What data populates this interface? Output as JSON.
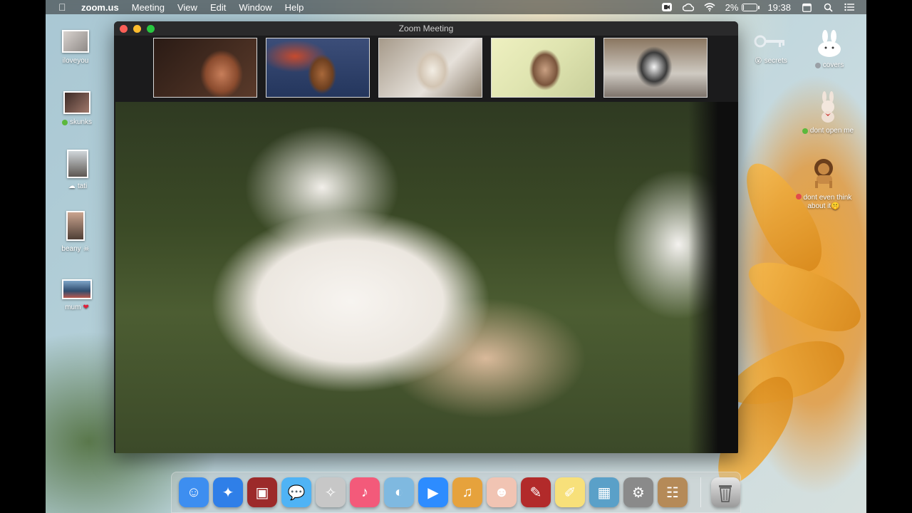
{
  "menubar": {
    "app_name": "zoom.us",
    "menus": [
      "Meeting",
      "View",
      "Edit",
      "Window",
      "Help"
    ],
    "battery_percent": "2%",
    "battery_level": 0.02,
    "clock": "19:38"
  },
  "window": {
    "title": "Zoom Meeting"
  },
  "desktop_left": [
    {
      "label": "iloveyou"
    },
    {
      "label": "skunks",
      "dot_color": "#5cb83c"
    },
    {
      "label": "tati",
      "prefix_glyph": "☁"
    },
    {
      "label": "beany",
      "suffix_glyph": "☠"
    },
    {
      "label": "mum",
      "suffix_glyph": "❤"
    }
  ],
  "desktop_right": [
    {
      "label": "secrets",
      "prefix_glyph": "😮"
    },
    {
      "label": "covers",
      "dot_color": "#9aa0a6"
    },
    {
      "label": "dont open me",
      "dot_color": "#5cb83c"
    },
    {
      "label": "dont even think about it",
      "dot_color": "#e24b4b",
      "suffix_glyph": "🤫"
    }
  ],
  "dock": [
    {
      "name": "finder-icon",
      "color": "#3d8ef0",
      "glyph": "☺"
    },
    {
      "name": "safari-icon",
      "color": "#2f7fe8",
      "glyph": "✦"
    },
    {
      "name": "photo-booth-icon",
      "color": "#9c2a2a",
      "glyph": "▣"
    },
    {
      "name": "messages-icon",
      "color": "#4fb3f5",
      "glyph": "💬"
    },
    {
      "name": "cyberduck-icon",
      "color": "#c7c7c7",
      "glyph": "✧"
    },
    {
      "name": "music-icon",
      "color": "#f35a7a",
      "glyph": "♪"
    },
    {
      "name": "sequel-pro-icon",
      "color": "#7fb9e0",
      "glyph": "◐"
    },
    {
      "name": "zoom-icon",
      "color": "#2d8cff",
      "glyph": "▶"
    },
    {
      "name": "garageband-icon",
      "color": "#e6a23c",
      "glyph": "♫"
    },
    {
      "name": "avatar-app-icon",
      "color": "#f1c4b3",
      "glyph": "☻"
    },
    {
      "name": "photo-editor-icon",
      "color": "#b22a2a",
      "glyph": "✎"
    },
    {
      "name": "stickies-icon",
      "color": "#f7e07a",
      "glyph": "✐"
    },
    {
      "name": "preview-icon",
      "color": "#5aa0c8",
      "glyph": "▦"
    },
    {
      "name": "system-preferences-icon",
      "color": "#8a8a8a",
      "glyph": "⚙"
    },
    {
      "name": "contacts-icon",
      "color": "#b58a58",
      "glyph": "☷"
    }
  ],
  "colors": {
    "menubar_bg": "#2a2a2a",
    "window_bg": "#1b1b1c",
    "traffic_close": "#fc5f57",
    "traffic_min": "#fdbc2e",
    "traffic_max": "#28c840"
  }
}
